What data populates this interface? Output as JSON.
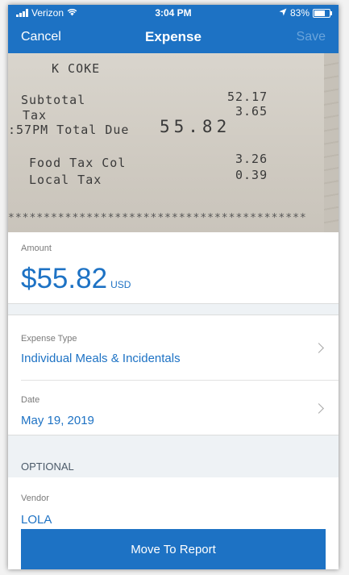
{
  "status_bar": {
    "carrier": "Verizon",
    "time": "3:04 PM",
    "battery": "83%",
    "battery_level": 0.83
  },
  "nav": {
    "cancel": "Cancel",
    "title": "Expense",
    "save": "Save"
  },
  "receipt": {
    "line1": "K COKE",
    "subtotal_label": "Subtotal",
    "subtotal_value": "52.17",
    "tax_label": "Tax",
    "tax_value": "3.65",
    "total_prefix": ":57PM Total Due",
    "total_value": "55.82",
    "food_tax_label": "Food Tax Col",
    "food_tax_value": "3.26",
    "local_tax_label": "Local Tax",
    "local_tax_value": "0.39",
    "stars": "******************************************"
  },
  "amount": {
    "label": "Amount",
    "value": "$55.82",
    "currency": "USD"
  },
  "expense_type": {
    "label": "Expense Type",
    "value": "Individual Meals & Incidentals"
  },
  "date": {
    "label": "Date",
    "value": "May 19, 2019"
  },
  "optional": {
    "header": "OPTIONAL"
  },
  "vendor": {
    "label": "Vendor",
    "value": "LOLA"
  },
  "footer": {
    "button": "Move To Report"
  },
  "colors": {
    "accent": "#1d72c4",
    "section_bg": "#eef2f5"
  }
}
